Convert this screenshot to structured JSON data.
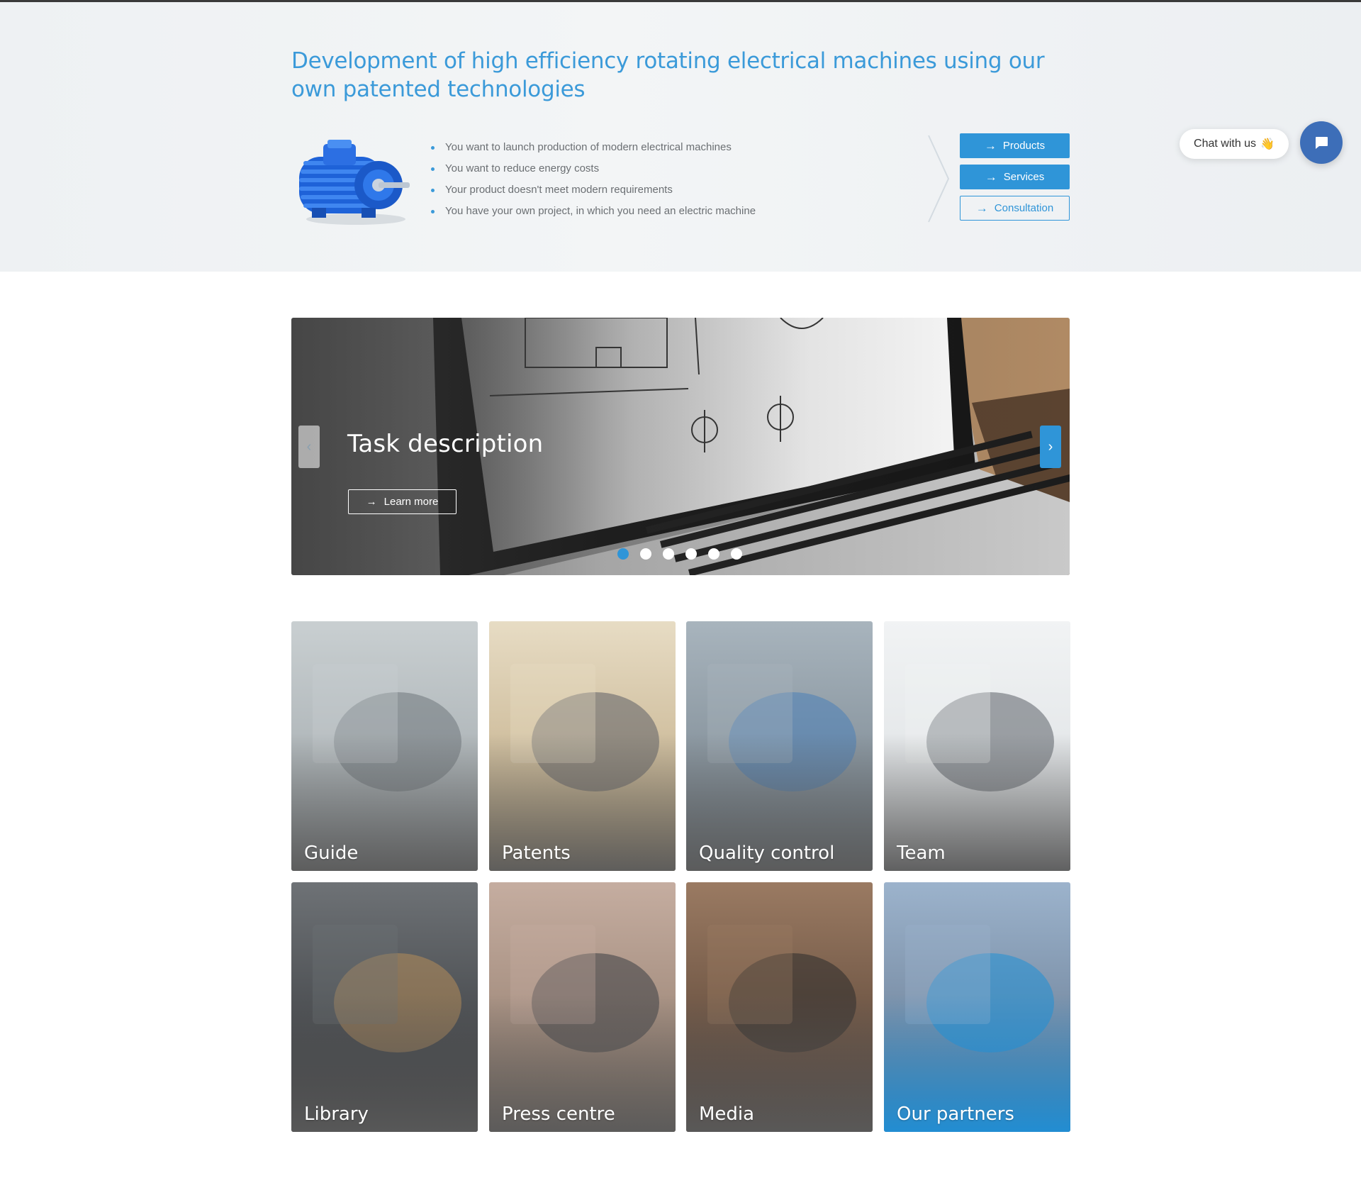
{
  "hero": {
    "title": "Development of high efficiency rotating electrical machines using our own patented technologies",
    "bullets": [
      "You want to launch production of modern electrical machines",
      "You want to reduce energy costs",
      "Your product doesn't meet modern requirements",
      "You have your own project, in which you need an electric machine"
    ],
    "buttons": {
      "products": "Products",
      "services": "Services",
      "consultation": "Consultation"
    },
    "arrow_glyph": "→"
  },
  "chat": {
    "label": "Chat with us",
    "emoji": "👋"
  },
  "slider": {
    "caption": "Task description",
    "learn_more": "Learn more",
    "prev_glyph": "‹",
    "next_glyph": "›",
    "dot_count": 6,
    "active_dot": 1
  },
  "tiles": [
    {
      "label": "Guide"
    },
    {
      "label": "Patents"
    },
    {
      "label": "Quality control"
    },
    {
      "label": "Team"
    },
    {
      "label": "Library"
    },
    {
      "label": "Press centre"
    },
    {
      "label": "Media"
    },
    {
      "label": "Our partners"
    }
  ],
  "colors": {
    "accent": "#2f95d8",
    "title": "#3b9ad9",
    "chat_button": "#3d6eb8"
  }
}
